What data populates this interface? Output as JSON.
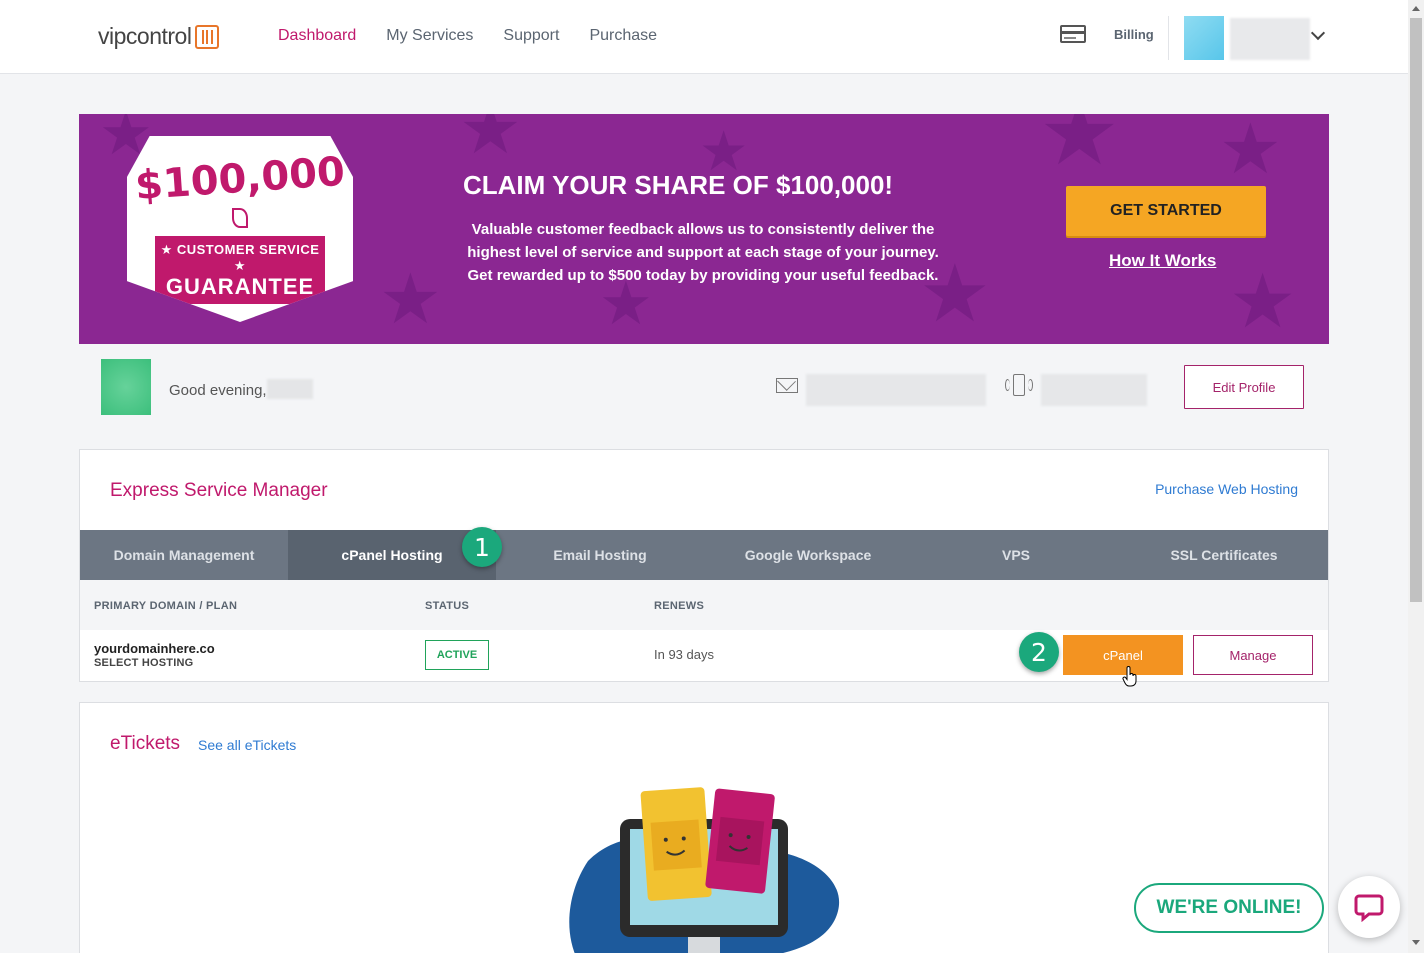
{
  "header": {
    "logo_text": "vipcontrol",
    "nav": [
      {
        "label": "Dashboard",
        "active": true
      },
      {
        "label": "My Services",
        "active": false
      },
      {
        "label": "Support",
        "active": false
      },
      {
        "label": "Purchase",
        "active": false
      }
    ],
    "billing_label": "Billing"
  },
  "banner": {
    "badge_amount": "$100,000",
    "badge_line1": "★ CUSTOMER SERVICE ★",
    "badge_line2": "GUARANTEE",
    "title": "CLAIM YOUR SHARE OF $100,000!",
    "text": "Valuable customer feedback allows us to consistently deliver the highest level of service and support at each stage of your journey. Get rewarded up to $500 today by providing your useful feedback.",
    "cta_label": "GET STARTED",
    "link_label": "How It Works",
    "bg_color": "#8b2792",
    "cta_color": "#f5a623"
  },
  "profile": {
    "greeting": "Good evening,",
    "edit_label": "Edit Profile"
  },
  "esm": {
    "title": "Express Service Manager",
    "purchase_link": "Purchase Web Hosting",
    "tabs": [
      {
        "label": "Domain Management",
        "active": false
      },
      {
        "label": "cPanel Hosting",
        "active": true
      },
      {
        "label": "Email Hosting",
        "active": false
      },
      {
        "label": "Google Workspace",
        "active": false
      },
      {
        "label": "VPS",
        "active": false
      },
      {
        "label": "SSL Certificates",
        "active": false
      }
    ],
    "columns": [
      "PRIMARY DOMAIN / PLAN",
      "STATUS",
      "RENEWS"
    ],
    "row": {
      "domain": "yourdomainhere.co",
      "plan": "SELECT HOSTING",
      "status": "ACTIVE",
      "renews": "In 93 days",
      "cpanel_label": "cPanel",
      "manage_label": "Manage"
    }
  },
  "steps": {
    "step1": "1",
    "step2": "2"
  },
  "etickets": {
    "title": "eTickets",
    "link": "See all eTickets"
  },
  "chat": {
    "online_label": "WE'RE ONLINE!"
  },
  "colors": {
    "accent": "#c0196c",
    "link": "#2f7bd2",
    "success": "#20a35a",
    "step_badge": "#1ba87c"
  }
}
